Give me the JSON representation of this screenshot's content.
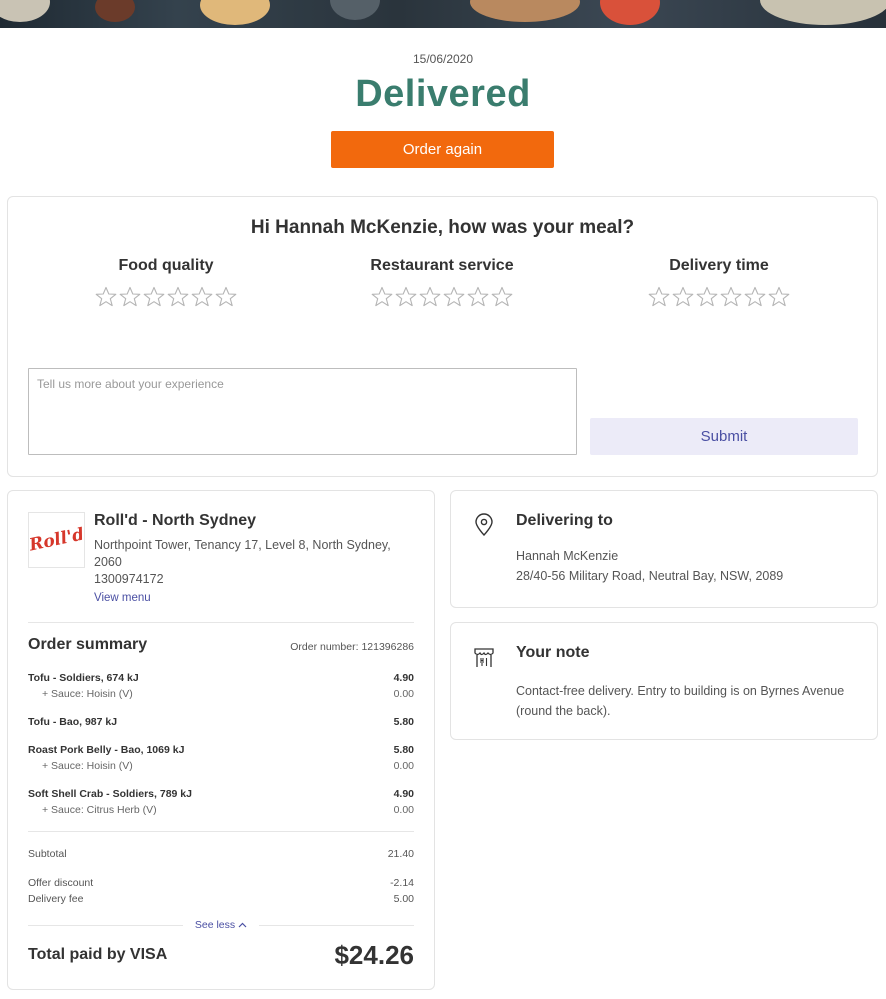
{
  "order": {
    "date": "15/06/2020",
    "status": "Delivered",
    "order_again_label": "Order again"
  },
  "rating": {
    "title": "Hi Hannah McKenzie, how was your meal?",
    "categories": [
      {
        "label": "Food quality",
        "stars": 0,
        "max": 6
      },
      {
        "label": "Restaurant service",
        "stars": 0,
        "max": 6
      },
      {
        "label": "Delivery time",
        "stars": 0,
        "max": 6
      }
    ],
    "feedback_placeholder": "Tell us more about your experience",
    "feedback_value": "",
    "submit_label": "Submit"
  },
  "restaurant": {
    "logo_text": "Roll'd",
    "name": "Roll'd - North Sydney",
    "address": "Northpoint Tower, Tenancy 17, Level 8, North Sydney, 2060",
    "phone": "1300974172",
    "view_menu_label": "View menu"
  },
  "summary": {
    "title": "Order summary",
    "order_number": "Order number: 121396286",
    "items": [
      {
        "name": "Tofu - Soldiers, 674 kJ",
        "price": "4.90",
        "subs": [
          {
            "name": "+ Sauce: Hoisin (V)",
            "price": "0.00"
          }
        ]
      },
      {
        "name": "Tofu - Bao, 987 kJ",
        "price": "5.80",
        "subs": []
      },
      {
        "name": "Roast Pork Belly - Bao, 1069 kJ",
        "price": "5.80",
        "subs": [
          {
            "name": "+ Sauce: Hoisin (V)",
            "price": "0.00"
          }
        ]
      },
      {
        "name": "Soft Shell Crab - Soldiers, 789 kJ",
        "price": "4.90",
        "subs": [
          {
            "name": "+ Sauce: Citrus Herb (V)",
            "price": "0.00"
          }
        ]
      }
    ],
    "subtotal_label": "Subtotal",
    "subtotal_value": "21.40",
    "discount_label": "Offer discount",
    "discount_value": "-2.14",
    "delivery_fee_label": "Delivery fee",
    "delivery_fee_value": "5.00",
    "see_less_label": "See less",
    "total_label": "Total paid by VISA",
    "total_value": "$24.26"
  },
  "delivery": {
    "title": "Delivering to",
    "name": "Hannah McKenzie",
    "address": "28/40-56 Military Road, Neutral Bay, NSW, 2089"
  },
  "note": {
    "title": "Your note",
    "text": "Contact-free delivery. Entry to building is on Byrnes Avenue (round the back)."
  },
  "colors": {
    "status": "#3a7d6e",
    "order_again_bg": "#f2690d",
    "submit_bg": "#ecebf8",
    "link": "#4a4fa3"
  },
  "icons": {
    "star": "star-outline-icon",
    "location": "map-pin-icon",
    "note": "restaurant-awning-icon",
    "chevron": "chevron-up-icon"
  }
}
